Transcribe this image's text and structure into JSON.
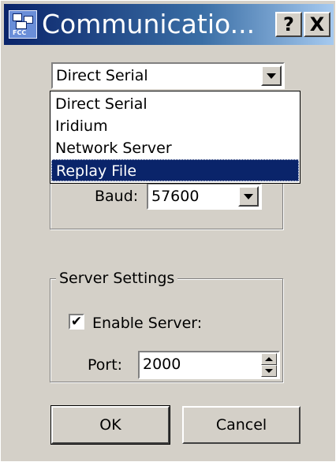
{
  "window": {
    "title": "Communicatio...",
    "help_label": "?",
    "close_label": "X",
    "icon_text": "FCC"
  },
  "connection": {
    "selected": "Direct Serial",
    "options": [
      "Direct Serial",
      "Iridium",
      "Network Server",
      "Replay File"
    ],
    "highlighted_option": "Replay File"
  },
  "serial": {
    "baud_label": "Baud:",
    "baud_value": "57600"
  },
  "server": {
    "group_label": "Server Settings",
    "enable_label": "Enable Server:",
    "enable_checked": true,
    "check_mark": "✔",
    "port_label": "Port:",
    "port_value": "2000"
  },
  "buttons": {
    "ok": "OK",
    "cancel": "Cancel"
  },
  "colors": {
    "face": "#d4d0c8",
    "title_active": "#0a246a",
    "selection": "#0a246a"
  }
}
